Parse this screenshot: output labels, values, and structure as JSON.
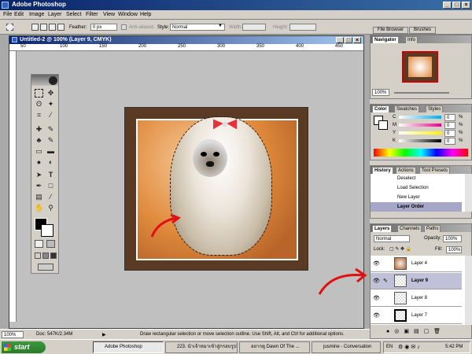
{
  "app": {
    "title": "Adobe Photoshop"
  },
  "menu": [
    "File",
    "Edit",
    "Image",
    "Layer",
    "Select",
    "Filter",
    "View",
    "Window",
    "Help"
  ],
  "options": {
    "feather_label": "Feather:",
    "feather_value": "0 px",
    "antialiased_label": "Anti-aliased",
    "style_label": "Style:",
    "style_value": "Normal",
    "width_label": "Width:",
    "height_label": "Height:"
  },
  "well": {
    "file_browser": "File Browser",
    "brushes": "Brushes"
  },
  "document": {
    "title": "Untitled-2 @ 100% (Layer 9, CMYK)"
  },
  "ruler_h": [
    "50",
    "100",
    "150",
    "200",
    "250",
    "300",
    "350",
    "400",
    "450",
    "500"
  ],
  "status": {
    "zoom": "100%",
    "doc": "Doc: 547K/2.34M",
    "hint": "Draw rectangular selection or move selection outline. Use Shift, Alt, and Ctrl for additional options."
  },
  "navigator": {
    "tabs": [
      "Navigator",
      "Info"
    ],
    "zoom": "100%"
  },
  "color": {
    "tabs": [
      "Color",
      "Swatches",
      "Styles"
    ],
    "channels": [
      {
        "label": "C",
        "value": "0",
        "pct": "%"
      },
      {
        "label": "M",
        "value": "0",
        "pct": "%"
      },
      {
        "label": "Y",
        "value": "0",
        "pct": "%"
      },
      {
        "label": "K",
        "value": "0",
        "pct": "%"
      }
    ]
  },
  "history": {
    "tabs": [
      "History",
      "Actions",
      "Tool Presets"
    ],
    "items": [
      "Deselect",
      "Load Selection",
      "New Layer",
      "Layer Order"
    ]
  },
  "layers": {
    "tabs": [
      "Layers",
      "Channels",
      "Paths"
    ],
    "blend_mode": "Normal",
    "opacity_label": "Opacity:",
    "opacity_value": "100%",
    "lock_label": "Lock:",
    "fill_label": "Fill:",
    "fill_value": "100%",
    "items": [
      {
        "name": "Layer 4",
        "selected": false
      },
      {
        "name": "Layer 9",
        "selected": true
      },
      {
        "name": "Layer 8",
        "selected": false
      },
      {
        "name": "Layer 7",
        "selected": false
      }
    ]
  },
  "taskbar": {
    "start": "start",
    "tasks": [
      "Adobe Photoshop",
      "223. นำเจ้าหมาเข้าสู่กรอบรูป...",
      "อยากดู Dawn Of The ...",
      "jusmine - Conversation"
    ],
    "lang": "EN",
    "time": "5:42 PM"
  },
  "colors": {
    "annotation_arrow": "#e01010",
    "bow": "#e8303a"
  }
}
